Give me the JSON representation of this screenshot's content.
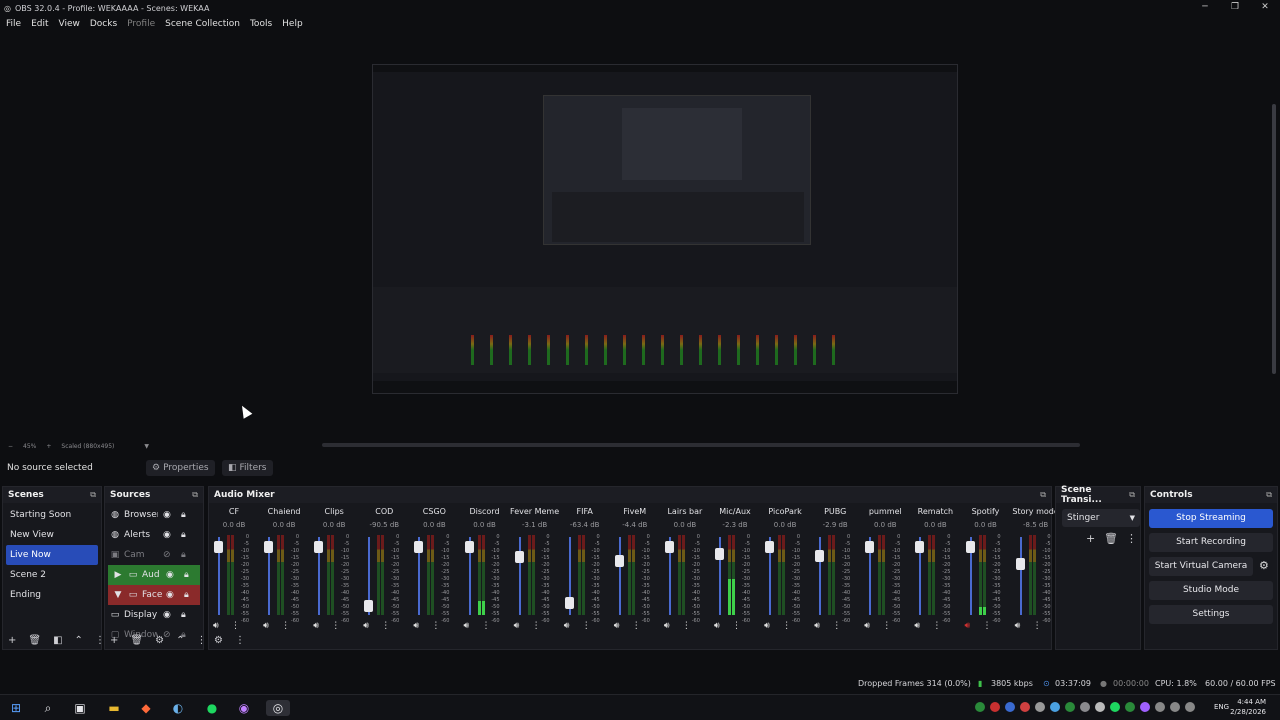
{
  "window": {
    "title": "OBS 32.0.4 - Profile: WEKAAAA - Scenes: WEKAA",
    "min": "─",
    "max": "❐",
    "close": "✕"
  },
  "menu": [
    "File",
    "Edit",
    "View",
    "Docks",
    "Profile",
    "Scene Collection",
    "Tools",
    "Help"
  ],
  "preview": {
    "zoom": "45%",
    "scale": "Scaled (880x495)",
    "minus": "−",
    "plus": "+"
  },
  "source_toolbar": {
    "no_source": "No source selected",
    "properties": "Properties",
    "filters": "Filters"
  },
  "scenes": {
    "title": "Scenes",
    "items": [
      "Starting Soon",
      "New View",
      "Live Now",
      "Scene 2",
      "Ending"
    ],
    "selected": "Live Now"
  },
  "sources": {
    "title": "Sources",
    "items": [
      {
        "name": "Browser",
        "icon": "globe-icon"
      },
      {
        "name": "Alerts",
        "icon": "globe-icon"
      },
      {
        "name": "Cam",
        "icon": "camera-icon"
      },
      {
        "name": "Aud",
        "icon": "folder-icon"
      },
      {
        "name": "Face",
        "icon": "folder-icon"
      },
      {
        "name": "Display",
        "icon": "monitor-icon"
      },
      {
        "name": "Window",
        "icon": "window-icon"
      }
    ]
  },
  "mixer": {
    "title": "Audio Mixer",
    "channels": [
      {
        "name": "CF",
        "db": "0.0 dB",
        "level": 0.0,
        "fader": 0.95
      },
      {
        "name": "Chaiend",
        "db": "0.0 dB",
        "level": 0.0,
        "fader": 0.95
      },
      {
        "name": "Clips",
        "db": "0.0 dB",
        "level": 0.0,
        "fader": 0.95
      },
      {
        "name": "COD",
        "db": "-90.5 dB",
        "level": 0.0,
        "fader": 0.1
      },
      {
        "name": "CSGO",
        "db": "0.0 dB",
        "level": 0.0,
        "fader": 0.95
      },
      {
        "name": "Discord",
        "db": "0.0 dB",
        "level": 0.18,
        "fader": 0.95
      },
      {
        "name": "Fever Meme",
        "db": "-3.1 dB",
        "level": 0.0,
        "fader": 0.8
      },
      {
        "name": "FIFA",
        "db": "-63.4 dB",
        "level": 0.0,
        "fader": 0.15
      },
      {
        "name": "FiveM",
        "db": "-4.4 dB",
        "level": 0.0,
        "fader": 0.75
      },
      {
        "name": "Lairs bar",
        "db": "0.0 dB",
        "level": 0.0,
        "fader": 0.95
      },
      {
        "name": "Mic/Aux",
        "db": "-2.3 dB",
        "level": 0.45,
        "fader": 0.85
      },
      {
        "name": "PicoPark",
        "db": "0.0 dB",
        "level": 0.0,
        "fader": 0.95
      },
      {
        "name": "PUBG",
        "db": "-2.9 dB",
        "level": 0.0,
        "fader": 0.82
      },
      {
        "name": "pummel",
        "db": "0.0 dB",
        "level": 0.0,
        "fader": 0.95
      },
      {
        "name": "Rematch",
        "db": "0.0 dB",
        "level": 0.0,
        "fader": 0.95
      },
      {
        "name": "Spotify",
        "db": "0.0 dB",
        "level": 0.1,
        "fader": 0.95
      },
      {
        "name": "Story mode",
        "db": "-8.5 dB",
        "level": 0.0,
        "fader": 0.7
      }
    ],
    "scale": [
      "0",
      "-5",
      "-10",
      "-15",
      "-20",
      "-25",
      "-30",
      "-35",
      "-40",
      "-45",
      "-50",
      "-55",
      "-60"
    ]
  },
  "transitions": {
    "title": "Scene Transi...",
    "selected": "Stinger"
  },
  "controls": {
    "title": "Controls",
    "stop_streaming": "Stop Streaming",
    "start_recording": "Start Recording",
    "start_virtual_camera": "Start Virtual Camera",
    "studio_mode": "Studio Mode",
    "settings": "Settings"
  },
  "status": {
    "dropped": "Dropped Frames 314 (0.0%)",
    "bitrate": "3805 kbps",
    "stream_time": "03:37:09",
    "rec_time": "00:00:00",
    "cpu": "CPU: 1.8%",
    "fps": "60.00 / 60.00 FPS"
  },
  "taskbar": {
    "time": "4:44 AM",
    "date": "2/28/2026",
    "lang": "ENG"
  },
  "colors": {
    "accent": "#2a58d0",
    "group_green": "#2c7a30",
    "group_red": "#8a2a2a"
  }
}
